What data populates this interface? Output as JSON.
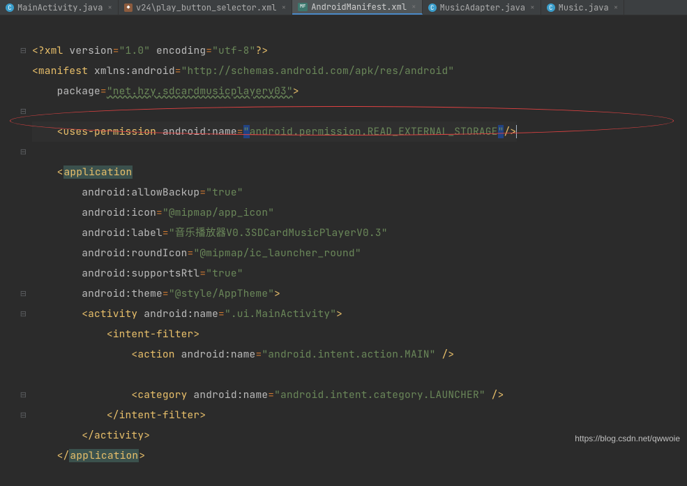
{
  "tabs": [
    {
      "label": "MainActivity.java",
      "icon": "c"
    },
    {
      "label": "v24\\play_button_selector.xml",
      "icon": "xml"
    },
    {
      "label": "AndroidManifest.xml",
      "icon": "mf",
      "active": true
    },
    {
      "label": "MusicAdapter.java",
      "icon": "c"
    },
    {
      "label": "Music.java",
      "icon": "c"
    }
  ],
  "code": {
    "xml_decl_q": "?",
    "xml_decl_name": "xml",
    "version_attr": "version",
    "version_val": "\"1.0\"",
    "encoding_attr": "encoding",
    "encoding_val": "\"utf-8\"",
    "manifest": "manifest",
    "xmlns": "xmlns:",
    "android": "android",
    "xmlns_val": "\"http://schemas.android.com/apk/res/android\"",
    "package_attr": "package",
    "package_val": "\"net.hzy.sdcardmusicplayerv03\"",
    "uses_perm": "uses-permission",
    "name_attr": "name",
    "perm_val_open": "\"",
    "perm_val_body": "android.permission.READ_EXTERNAL_STORAGE",
    "perm_val_close": "\"",
    "application": "application",
    "allowBackup": "allowBackup",
    "true_val": "\"true\"",
    "icon_attr": "icon",
    "icon_val": "\"@mipmap/app_icon\"",
    "label_attr": "label",
    "label_val": "\"音乐播放器V0.3SDCardMusicPlayerV0.3\"",
    "roundIcon": "roundIcon",
    "roundIcon_val": "\"@mipmap/ic_launcher_round\"",
    "supportsRtl": "supportsRtl",
    "theme": "theme",
    "theme_val": "\"@style/AppTheme\"",
    "activity": "activity",
    "activity_name_val": "\".ui.MainActivity\"",
    "intent_filter": "intent-filter",
    "action": "action",
    "action_val": "\"android.intent.action.MAIN\"",
    "category": "category",
    "category_val": "\"android.intent.category.LAUNCHER\""
  },
  "watermark": "https://blog.csdn.net/qwwoie"
}
